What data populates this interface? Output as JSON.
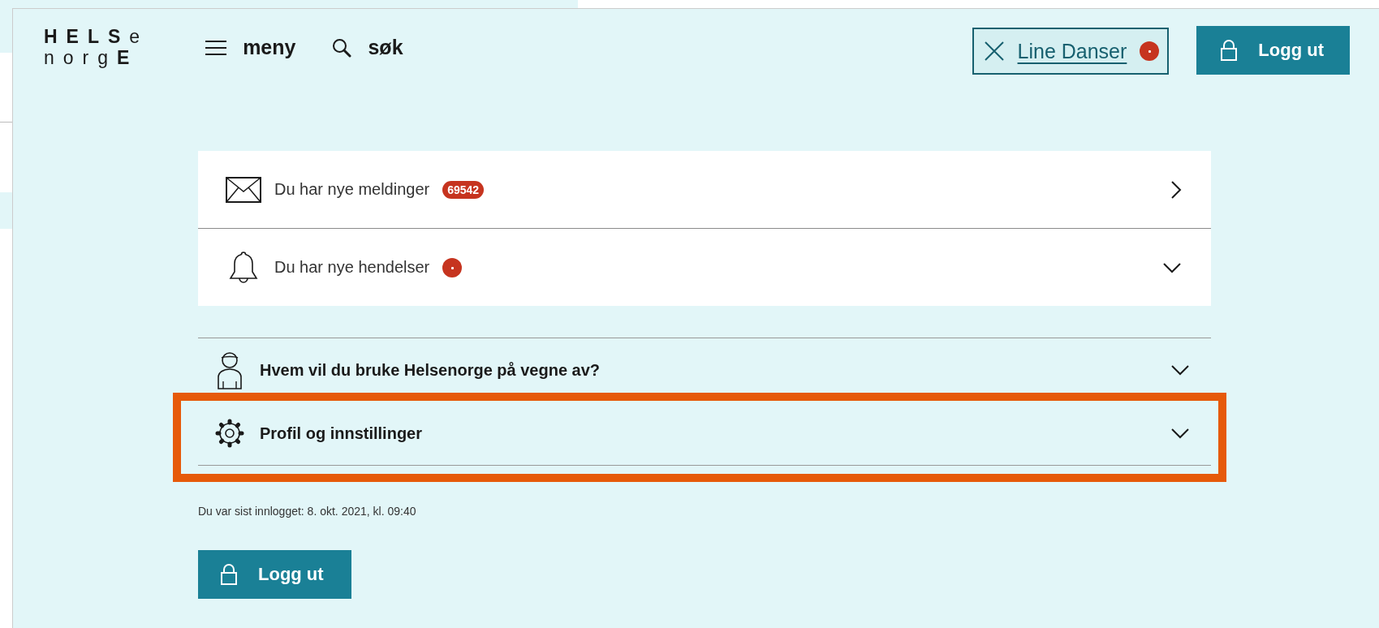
{
  "header": {
    "logo": [
      "**HELS**e",
      "norg**E**"
    ],
    "menu_label": "meny",
    "search_label": "søk",
    "user": {
      "name": "Line Danser",
      "notification_dot": true
    },
    "logout_label": "Logg ut"
  },
  "cards": [
    {
      "kind": "messages",
      "label": "Du har nye meldinger",
      "badge": {
        "kind": "count",
        "text": "69542"
      }
    },
    {
      "kind": "events",
      "label": "Du har nye hendelser",
      "badge": {
        "kind": "dot"
      }
    }
  ],
  "accordion": [
    {
      "kind": "person",
      "label": "Hvem vil du bruke Helsenorge på vegne av?",
      "expanded": false,
      "highlighted": false
    },
    {
      "kind": "settings",
      "label": "Profil og innstillinger",
      "expanded": false,
      "highlighted": true
    }
  ],
  "last_login": "Du var sist innlogget: 8. okt. 2021, kl. 09:40",
  "logout_button": "Logg ut"
}
